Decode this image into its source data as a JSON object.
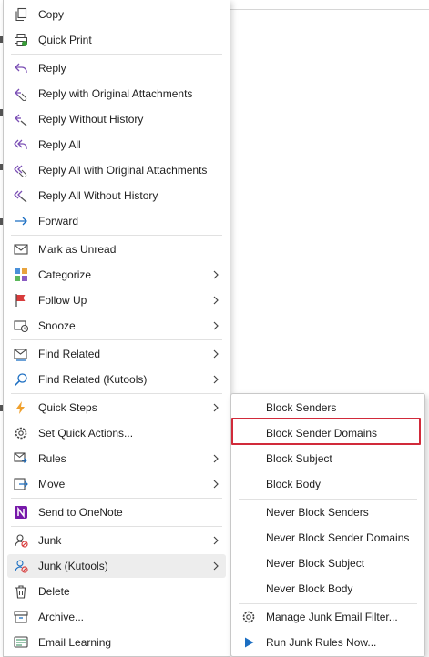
{
  "context_menu": {
    "items": [
      {
        "label": "Copy",
        "icon": "copy-icon"
      },
      {
        "label": "Quick Print",
        "icon": "quick-print-icon"
      },
      {
        "label": "Reply",
        "icon": "reply-icon"
      },
      {
        "label": "Reply with Original Attachments",
        "icon": "reply-attachments-icon"
      },
      {
        "label": "Reply Without History",
        "icon": "reply-no-history-icon"
      },
      {
        "label": "Reply All",
        "icon": "reply-all-icon"
      },
      {
        "label": "Reply All with Original Attachments",
        "icon": "reply-all-attachments-icon"
      },
      {
        "label": "Reply All Without History",
        "icon": "reply-all-no-history-icon"
      },
      {
        "label": "Forward",
        "icon": "forward-icon"
      },
      {
        "label": "Mark as Unread",
        "icon": "envelope-icon"
      },
      {
        "label": "Categorize",
        "icon": "categorize-icon"
      },
      {
        "label": "Follow Up",
        "icon": "flag-icon"
      },
      {
        "label": "Snooze",
        "icon": "snooze-icon"
      },
      {
        "label": "Find Related",
        "icon": "find-related-icon"
      },
      {
        "label": "Find Related (Kutools)",
        "icon": "search-icon"
      },
      {
        "label": "Quick Steps",
        "icon": "lightning-icon"
      },
      {
        "label": "Set Quick Actions...",
        "icon": "gear-icon"
      },
      {
        "label": "Rules",
        "icon": "rules-icon"
      },
      {
        "label": "Move",
        "icon": "move-icon"
      },
      {
        "label": "Send to OneNote",
        "icon": "onenote-icon"
      },
      {
        "label": "Junk",
        "icon": "junk-icon"
      },
      {
        "label": "Junk (Kutools)",
        "icon": "junk-kutools-icon"
      },
      {
        "label": "Delete",
        "icon": "trash-icon"
      },
      {
        "label": "Archive...",
        "icon": "archive-icon"
      },
      {
        "label": "Email Learning",
        "icon": "email-learning-icon"
      }
    ]
  },
  "junk_submenu": {
    "items": [
      {
        "label": "Block Senders"
      },
      {
        "label": "Block Sender Domains"
      },
      {
        "label": "Block Subject"
      },
      {
        "label": "Block Body"
      },
      {
        "label": "Never Block Senders"
      },
      {
        "label": "Never Block Sender Domains"
      },
      {
        "label": "Never Block Subject"
      },
      {
        "label": "Never Block Body"
      },
      {
        "label": "Manage Junk Email Filter...",
        "icon": "gear-icon"
      },
      {
        "label": "Run Junk Rules Now...",
        "icon": "play-icon"
      }
    ]
  },
  "colors": {
    "accent": "#1b6ec2",
    "highlight_border": "#d12a3a",
    "hover": "#ededed"
  }
}
